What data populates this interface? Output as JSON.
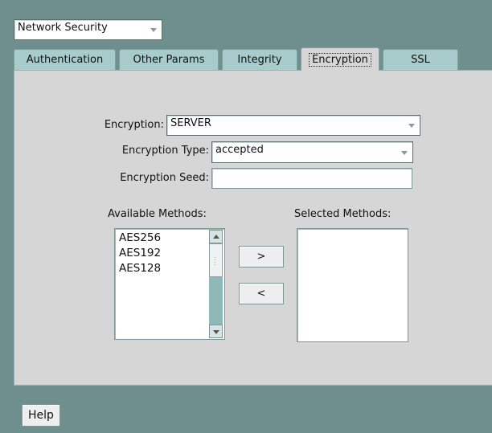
{
  "category_select": {
    "value": "Network Security"
  },
  "tabs": [
    {
      "label": "Authentication"
    },
    {
      "label": "Other Params"
    },
    {
      "label": "Integrity"
    },
    {
      "label": "Encryption"
    },
    {
      "label": "SSL"
    }
  ],
  "form": {
    "encryption_label": "Encryption:",
    "encryption_value": "SERVER",
    "encryption_type_label": "Encryption Type:",
    "encryption_type_value": "accepted",
    "encryption_seed_label": "Encryption Seed:",
    "encryption_seed_value": ""
  },
  "methods": {
    "available_label": "Available Methods:",
    "selected_label": "Selected Methods:",
    "available": [
      "AES256",
      "AES192",
      "AES128"
    ],
    "selected": [],
    "add_label": ">",
    "remove_label": "<"
  },
  "footer": {
    "help_label": "Help"
  },
  "colors": {
    "background": "#6f8f8f",
    "panel": "#d6d6d6",
    "tab": "#a8cccc",
    "scrollbar": "#8fb8b8"
  }
}
